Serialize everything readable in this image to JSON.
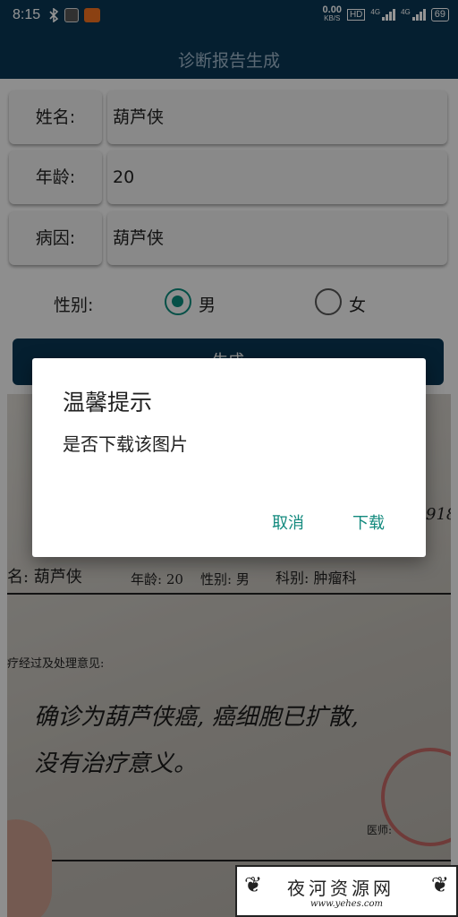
{
  "status_bar": {
    "time": "8:15",
    "net_speed": "0.00",
    "net_unit": "KB/S",
    "hd": "HD",
    "sim1": "4G",
    "sim2": "4G",
    "battery": "69"
  },
  "app_bar": {
    "title": "诊断报告生成"
  },
  "form": {
    "name_label": "姓名:",
    "name_value": "葫芦侠",
    "age_label": "年龄:",
    "age_value": "20",
    "disease_label": "病因:",
    "disease_value": "葫芦侠",
    "gender_label": "性别:",
    "gender_male": "男",
    "gender_female": "女",
    "gender_selected": "男"
  },
  "generate_button": {
    "label": "生成"
  },
  "preview": {
    "doc_number": "918",
    "name_line": "名: 葫芦侠",
    "age_line": "年龄: 20",
    "gender_line": "性别: 男",
    "dept_line": "科别: 肿瘤科",
    "section_title": "疗经过及处理意见:",
    "diagnosis_line1": "确诊为葫芦侠癌, 癌细胞已扩散,",
    "diagnosis_line2": "没有治疗意义。",
    "doctor_label": "医师:"
  },
  "dialog": {
    "title": "温馨提示",
    "message": "是否下载该图片",
    "cancel_label": "取消",
    "confirm_label": "下载"
  },
  "watermark": {
    "text": "夜河资源网",
    "url": "www.yehes.com"
  },
  "colors": {
    "primary": "#0a3654",
    "accent": "#138a7e"
  }
}
